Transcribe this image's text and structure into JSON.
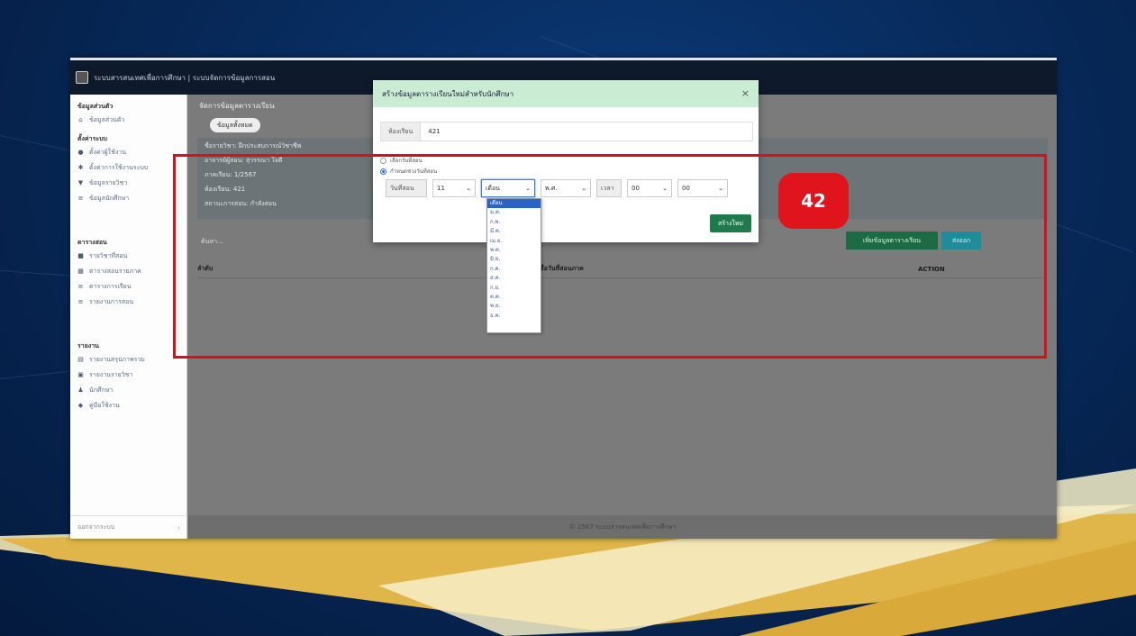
{
  "app": {
    "title": "ระบบสารสนเทศเพื่อการศึกษา | ระบบจัดการข้อมูลการสอน"
  },
  "sidebar": {
    "sections": [
      {
        "heading": "ข้อมูลส่วนตัว",
        "items": [
          {
            "label": "ข้อมูลส่วนตัว",
            "icon": "home-icon"
          }
        ]
      },
      {
        "heading": "ตั้งค่าระบบ",
        "items": [
          {
            "label": "ตั้งค่าผู้ใช้งาน",
            "icon": "user-icon"
          },
          {
            "label": "ตั้งค่าการใช้งานระบบ",
            "icon": "settings-icon"
          },
          {
            "label": "ข้อมูลรายวิชา",
            "icon": "book-icon"
          },
          {
            "label": "ข้อมูลนักศึกษา",
            "icon": "list-icon"
          }
        ]
      },
      {
        "heading": "ตารางสอน",
        "items": [
          {
            "label": "รายวิชาที่สอน",
            "icon": "book-icon"
          },
          {
            "label": "ตารางสอนรายภาค",
            "icon": "calendar-icon"
          },
          {
            "label": "ตารางการเรียน",
            "icon": "list-icon"
          },
          {
            "label": "รายงานการสอน",
            "icon": "list-icon"
          }
        ]
      },
      {
        "heading": "รายงาน",
        "items": [
          {
            "label": "รายงานสรุปภาพรวม",
            "icon": "chart-icon"
          },
          {
            "label": "รายงานรายวิชา",
            "icon": "file-icon"
          },
          {
            "label": "นักศึกษา",
            "icon": "users-icon"
          },
          {
            "label": "คู่มือใช้งาน",
            "icon": "help-icon"
          }
        ]
      }
    ],
    "footer_label": "ออกจากระบบ"
  },
  "page": {
    "header": "จัดการข้อมูลตารางเรียน",
    "pill_label": "ข้อมูลทั้งหมด",
    "info_lines": [
      "ชื่อรายวิชา: ฝึกประสบการณ์วิชาชีพ",
      "อาจารย์ผู้สอน: สุวรรณา ใจดี",
      "ภาคเรียน: 1/2567",
      "ห้องเรียน: 421",
      "สถานะการสอน: กำลังสอน"
    ],
    "search_placeholder": "ค้นหา...",
    "add_button": "เพิ่มข้อมูลตารางเรียน",
    "export_button": "ส่งออก",
    "columns": [
      "ลำดับ",
      "ชื่อวันที่สอนภาค",
      "ACTION"
    ],
    "footer": "© 2567 ระบบสารสนเทศเพื่อการศึกษา"
  },
  "modal": {
    "title": "สร้างข้อมูลตารางเรียนใหม่สำหรับนักศึกษา",
    "close": "×",
    "field_label": "ห้องเรียน",
    "field_value": "421",
    "radio1": "เลือกวันที่สอน",
    "radio2": "กำหนดช่วงวันที่สอน",
    "selects": {
      "day_label": "วันที่สอน",
      "day_value": "11",
      "month_value": "เดือน",
      "year_value": "พ.ศ.",
      "time_label": "เวลา",
      "hour_value": "00",
      "minute_value": "00"
    },
    "create_button": "สร้างใหม่"
  },
  "month_dropdown": {
    "options": [
      "เดือน",
      "ม.ค.",
      "ก.พ.",
      "มี.ค.",
      "เม.ย.",
      "พ.ค.",
      "มิ.ย.",
      "ก.ค.",
      "ส.ค.",
      "ก.ย.",
      "ต.ค.",
      "พ.ย.",
      "ธ.ค."
    ],
    "selected_index": 0
  },
  "annotation": {
    "step_number": "42",
    "color": "#d8101a"
  }
}
